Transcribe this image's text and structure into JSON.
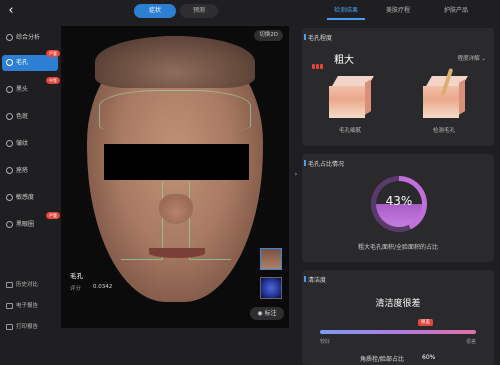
{
  "header": {
    "back_icon": "chevron-left-icon",
    "view_tabs": [
      {
        "label": "症状",
        "active": true
      },
      {
        "label": "预测",
        "active": false
      }
    ],
    "right_tabs": [
      {
        "label": "检测结果",
        "active": true
      },
      {
        "label": "美肤疗程",
        "active": false
      },
      {
        "label": "护肤产品",
        "active": false
      }
    ]
  },
  "sidebar": {
    "items": [
      {
        "label": "综合分析",
        "icon": "circle-icon",
        "active": false
      },
      {
        "label": "毛孔",
        "icon": "pore-icon",
        "active": true,
        "badge": "严重"
      },
      {
        "label": "黑头",
        "icon": "blackhead-icon",
        "active": false,
        "badge": "中等"
      },
      {
        "label": "色斑",
        "icon": "spot-icon",
        "active": false
      },
      {
        "label": "皱纹",
        "icon": "wrinkle-icon",
        "active": false
      },
      {
        "label": "痤疮",
        "icon": "acne-icon",
        "active": false
      },
      {
        "label": "敏感度",
        "icon": "sensitivity-icon",
        "active": false
      },
      {
        "label": "黑眼圈",
        "icon": "dark-circle-icon",
        "active": false,
        "badge": "严重"
      }
    ],
    "bottom_items": [
      {
        "label": "历史对比",
        "icon": "history-icon"
      },
      {
        "label": "电子报告",
        "icon": "report-icon"
      },
      {
        "label": "打印报告",
        "icon": "print-icon"
      }
    ]
  },
  "viewer": {
    "zoom_button": "切换2D",
    "metric_title": "毛孔",
    "metric_label": "评分",
    "metric_value": "0.0342",
    "tag_button": "标注",
    "collapse_icon": "chevron-right-icon"
  },
  "panels": {
    "severity": {
      "title": "毛孔程度",
      "level_text": "粗大",
      "details_link": "程度详解",
      "illustrations": [
        {
          "label": "毛孔细腻"
        },
        {
          "label": "检测毛孔"
        }
      ]
    },
    "ratio": {
      "title": "毛孔占比情况",
      "percent": "43%",
      "percent_value": 43,
      "caption": "粗大毛孔面积/全脸面积的占比"
    },
    "cleanliness": {
      "title": "清洁度",
      "headline": "清洁度很差",
      "marker": "很差",
      "scale_left": "较好",
      "scale_right": "很差",
      "keratin_label": "角质栓/脸部占比",
      "keratin_value": "60%"
    }
  },
  "colors": {
    "accent": "#2d7fd3",
    "severe": "#e2463e",
    "donut": "#c070d8"
  }
}
